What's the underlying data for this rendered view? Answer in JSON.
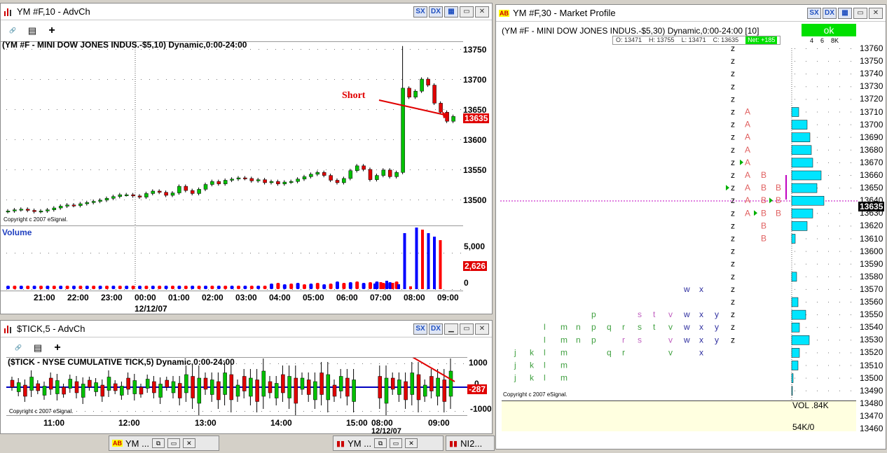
{
  "win_ym10": {
    "title": "YM #F,10 - AdvCh",
    "chart_title": "(YM #F - MINI DOW JONES INDUS.-$5,10) Dynamic,0:00-24:00",
    "price_labels": [
      "13750",
      "13700",
      "13650",
      "13600",
      "13550",
      "13500"
    ],
    "last_price": "13635",
    "annotation": "Short",
    "copyright": "Copyright c 2007 eSignal.",
    "volume_title": "Volume",
    "volume_labels": [
      "5,000",
      "0"
    ],
    "last_volume": "2,626",
    "time_labels": [
      "21:00",
      "22:00",
      "23:00",
      "00:00",
      "01:00",
      "02:00",
      "03:00",
      "04:00",
      "05:00",
      "06:00",
      "07:00",
      "08:00",
      "09:00"
    ],
    "date_label": "12/12/07"
  },
  "win_tick": {
    "title": "$TICK,5 - AdvCh",
    "chart_title": "($TICK - NYSE CUMULATIVE TICK,5) Dynamic,0:00-24:00",
    "value_labels": [
      "1000",
      "0",
      "-1000"
    ],
    "last_value": "-287",
    "copyright": "Copyright c 2007 eSignal.",
    "time_labels": [
      "11:00",
      "12:00",
      "13:00",
      "14:00",
      "15:00",
      "08:00",
      "09:00"
    ],
    "date_label": "12/12/07"
  },
  "win_mp": {
    "title": "YM #F,30 - Market Profile",
    "chart_title": "(YM #F - MINI DOW JONES INDUS.-$5,30) Dynamic,0:00-24:00 [10]",
    "ok_label": "ok",
    "ohlc": {
      "o": "O: 13471",
      "h": "H: 13755",
      "l": "L: 13471",
      "c": "C: 13635",
      "net": "Net: +185"
    },
    "scale_labels": [
      "4",
      "6",
      "8K"
    ],
    "price_labels": [
      "13760",
      "13750",
      "13740",
      "13730",
      "13720",
      "13710",
      "13700",
      "13690",
      "13680",
      "13670",
      "13660",
      "13650",
      "13640",
      "13630",
      "13620",
      "13610",
      "13600",
      "13590",
      "13580",
      "13570",
      "13560",
      "13550",
      "13540",
      "13530",
      "13520",
      "13510",
      "13500",
      "13490",
      "13480",
      "13470",
      "13460"
    ],
    "last_price": "13635",
    "copyright": "Copyright c 2007 eSignal.",
    "vol_label": "VOL .84K",
    "vol_sub": "54K/0"
  },
  "taskbar": {
    "btn1": "YM ...",
    "btn2": "YM ...",
    "btn3": "NI2..."
  },
  "toolbar": {
    "link": "LINK"
  },
  "colors": {
    "up": "#00c000",
    "down": "#e00000",
    "vol_up": "#0000ff",
    "vol_down": "#ff0000",
    "cyan": "#00e5ff",
    "ok": "#00e000"
  }
}
